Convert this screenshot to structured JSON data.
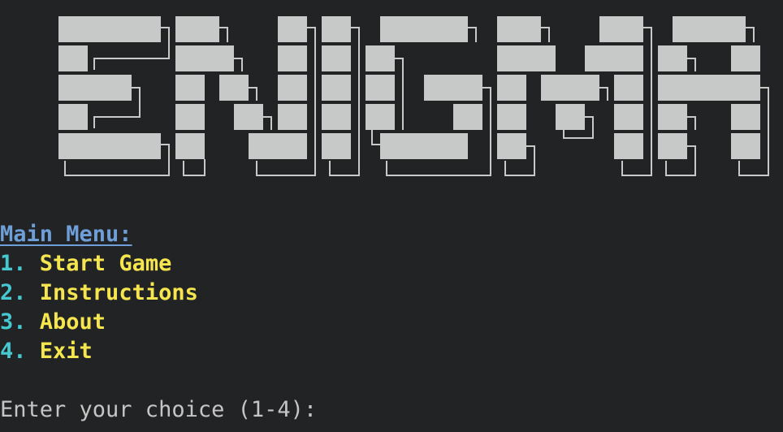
{
  "app": {
    "logo_text": "ENIGMA"
  },
  "menu": {
    "heading": "Main Menu:",
    "items": [
      {
        "number": "1.",
        "label": "Start Game"
      },
      {
        "number": "2.",
        "label": "Instructions"
      },
      {
        "number": "3.",
        "label": "About"
      },
      {
        "number": "4.",
        "label": "Exit"
      }
    ]
  },
  "input": {
    "prompt": "Enter your choice (1-4):"
  },
  "colors": {
    "background": "#222324",
    "logo": "#c7c9c9",
    "heading": "#6f9fd8",
    "option_number": "#45c8cf",
    "option_label": "#f5e64f",
    "prompt": "#c5c5c5"
  }
}
